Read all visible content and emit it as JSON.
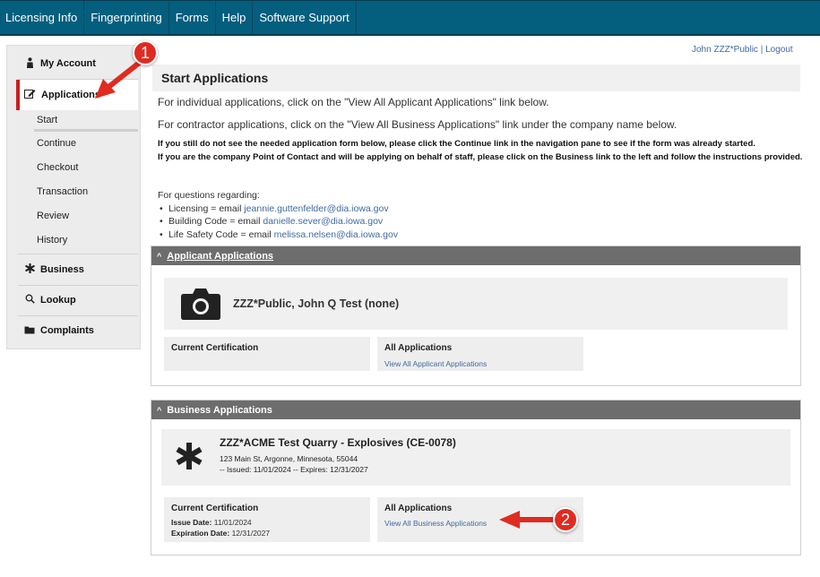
{
  "topnav": [
    "Licensing Info",
    "Fingerprinting",
    "Forms",
    "Help",
    "Software Support"
  ],
  "user": {
    "name": "John ZZZ*Public",
    "separator": "|",
    "logout": "Logout"
  },
  "sidebar": {
    "my_account": "My Account",
    "applications": "Applications",
    "sub": [
      "Start",
      "Continue",
      "Checkout",
      "Transaction",
      "Review",
      "History"
    ],
    "business": "Business",
    "lookup": "Lookup",
    "complaints": "Complaints"
  },
  "main": {
    "heading": "Start Applications",
    "line1": "For individual applications, click on the \"View All Applicant Applications\" link below.",
    "line2": "For contractor applications, click on the \"View All Business Applications\" link under  the company name below.",
    "bold1": "If you still do not see the needed application form below, please click the Continue link in the navigation pane to see if the form was already started.",
    "bold2": "If you are the company Point of Contact and will be applying on behalf of staff, please click on the Business link to the left and follow the instructions provided.",
    "questions_title": "For questions regarding:",
    "questions": [
      {
        "label": "Licensing = email ",
        "email": "jeannie.guttenfelder@dia.iowa.gov"
      },
      {
        "label": "Building Code = email ",
        "email": "danielle.sever@dia.iowa.gov"
      },
      {
        "label": "Life Safety Code = email ",
        "email": "melissa.nelsen@dia.iowa.gov"
      }
    ]
  },
  "applicant_panel": {
    "title": "Applicant Applications",
    "name": "ZZZ*Public, John Q Test (none)",
    "current_cert": "Current Certification",
    "all_apps": "All Applications",
    "link": "View All Applicant Applications"
  },
  "business_panel": {
    "title": "Business Applications",
    "name": "ZZZ*ACME Test Quarry - Explosives (CE-0078)",
    "address": "123 Main St, Argonne, Minnesota, 55044",
    "dates": "-- Issued: 11/01/2024 -- Expires: 12/31/2027",
    "current_cert": "Current Certification",
    "issue_label": "Issue Date:",
    "issue_value": "11/01/2024",
    "exp_label": "Expiration Date:",
    "exp_value": "12/31/2027",
    "all_apps": "All Applications",
    "link": "View All Business Applications"
  },
  "callouts": [
    "1",
    "2"
  ],
  "colors": {
    "nav": "#045e7d",
    "accent_red": "#e02b20",
    "link": "#3f6aa0",
    "panel_head": "#6d6d6d"
  }
}
